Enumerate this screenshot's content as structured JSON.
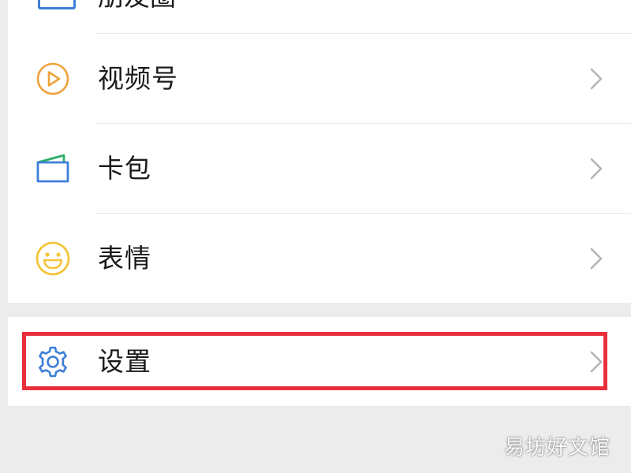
{
  "partial_item": {
    "label": "朋友圈",
    "icon": "album-icon"
  },
  "menu_items": [
    {
      "id": "channels",
      "label": "视频号",
      "icon": "channels-play-icon"
    },
    {
      "id": "cards",
      "label": "卡包",
      "icon": "card-wallet-icon"
    },
    {
      "id": "stickers",
      "label": "表情",
      "icon": "smiley-face-icon"
    }
  ],
  "settings_item": {
    "label": "设置",
    "icon": "gear-icon"
  },
  "watermark": "易坊好文馆",
  "colors": {
    "background": "#ececec",
    "card": "#ffffff",
    "text": "#1b1b1b",
    "chevron": "#b5b5b5",
    "divider": "#e8e8e8",
    "channels_orange": "#f0a23c",
    "card_blue": "#3d7fd8",
    "card_green": "#2aae67",
    "smiley_yellow": "#f4c43a",
    "gear_blue": "#3d7fd8",
    "highlight_red": "#e8303c"
  }
}
